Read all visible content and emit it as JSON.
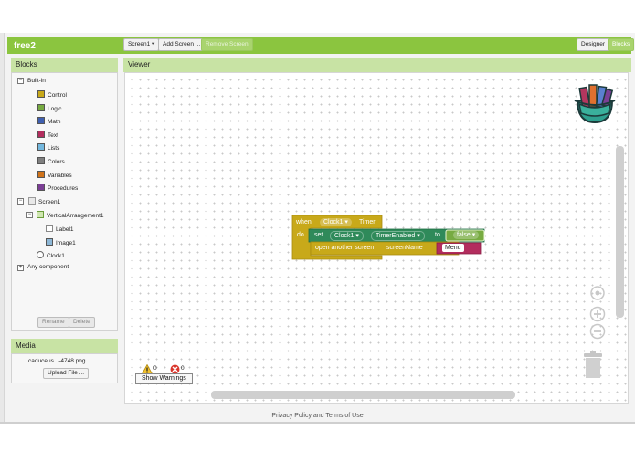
{
  "app": {
    "title": "free2"
  },
  "toolbar": {
    "screen_select": "Screen1 ▾",
    "add_screen": "Add Screen ...",
    "remove_screen": "Remove Screen",
    "designer": "Designer",
    "blocks": "Blocks"
  },
  "blocks_panel": {
    "title": "Blocks",
    "builtin_label": "Built-in",
    "builtin": [
      {
        "label": "Control",
        "color": "#c8a91a"
      },
      {
        "label": "Logic",
        "color": "#77ab41"
      },
      {
        "label": "Math",
        "color": "#3f5fb0"
      },
      {
        "label": "Text",
        "color": "#b32d5e"
      },
      {
        "label": "Lists",
        "color": "#74b8de"
      },
      {
        "label": "Colors",
        "color": "#7f7f7f"
      },
      {
        "label": "Variables",
        "color": "#d0731a"
      },
      {
        "label": "Procedures",
        "color": "#7b3f95"
      }
    ],
    "screen_label": "Screen1",
    "arrangement_label": "VerticalArrangement1",
    "label1": "Label1",
    "image1": "Image1",
    "clock1": "Clock1",
    "any_component": "Any component",
    "rename_button": "Rename",
    "delete_button": "Delete"
  },
  "media": {
    "title": "Media",
    "file": "caduceus...-4748.png",
    "upload_button": "Upload File ..."
  },
  "viewer": {
    "title": "Viewer",
    "event_block": {
      "when": "when",
      "component": "Clock1 ▾",
      "event": "Timer",
      "do": "do",
      "set": "set",
      "set_component": "Clock1 ▾",
      "property": "TimerEnabled ▾",
      "to": "to",
      "value": "false ▾",
      "open_screen": "open another screen",
      "screen_name": "screenName",
      "screen_value": "Menu"
    },
    "warnings_count": "0",
    "errors_count": "0",
    "show_warnings": "Show Warnings"
  },
  "footer": {
    "link": "Privacy Policy and Terms of Use"
  },
  "colors": {
    "topbar": "#8bc53f",
    "panel_head": "#c8e3a4",
    "control": "#c8a91a",
    "setter": "#2f8a5a",
    "logic": "#77ab41",
    "text": "#b32d5e"
  }
}
